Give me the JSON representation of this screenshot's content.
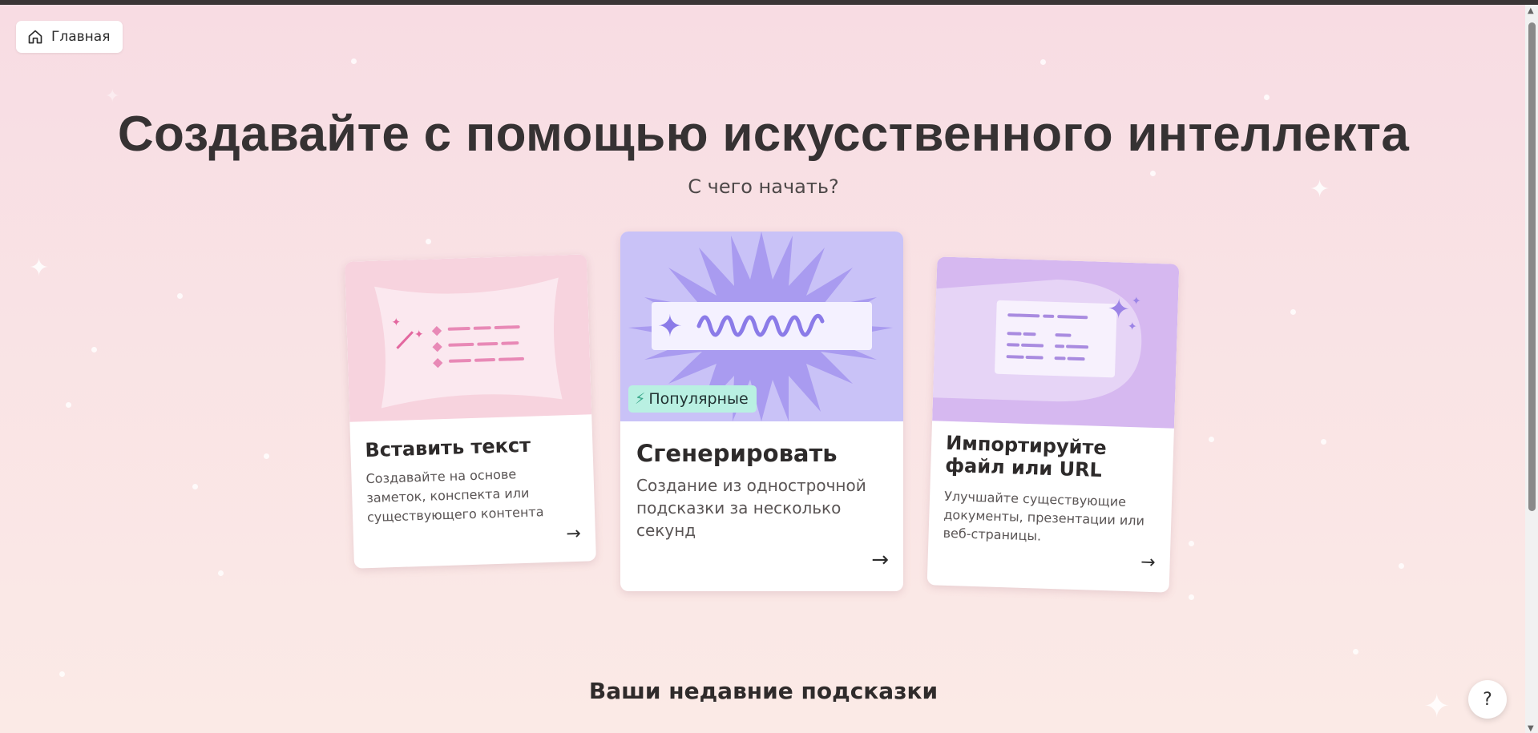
{
  "nav": {
    "home_label": "Главная",
    "home_icon": "home-icon"
  },
  "hero": {
    "title": "Создавайте с помощью искусственного интеллекта",
    "subtitle": "С чего начать?"
  },
  "cards": [
    {
      "title": "Вставить текст",
      "description": "Создавайте на основе заметок, конспекта или существующего контента",
      "arrow": "→"
    },
    {
      "title": "Сгенерировать",
      "description": "Создание из однострочной подсказки за несколько секунд",
      "badge": "Популярные",
      "badge_icon": "lightning-icon",
      "arrow": "→"
    },
    {
      "title": "Импортируйте файл или URL",
      "description": "Улучшайте существующие документы, презентации или веб-страницы.",
      "arrow": "→"
    }
  ],
  "recent": {
    "title": "Ваши недавние подсказки"
  },
  "help": {
    "label": "?"
  },
  "colors": {
    "background": "#f8dce3",
    "accent_purple": "#9b8cf0",
    "badge": "#b9f0e2",
    "pink": "#e889b6"
  }
}
